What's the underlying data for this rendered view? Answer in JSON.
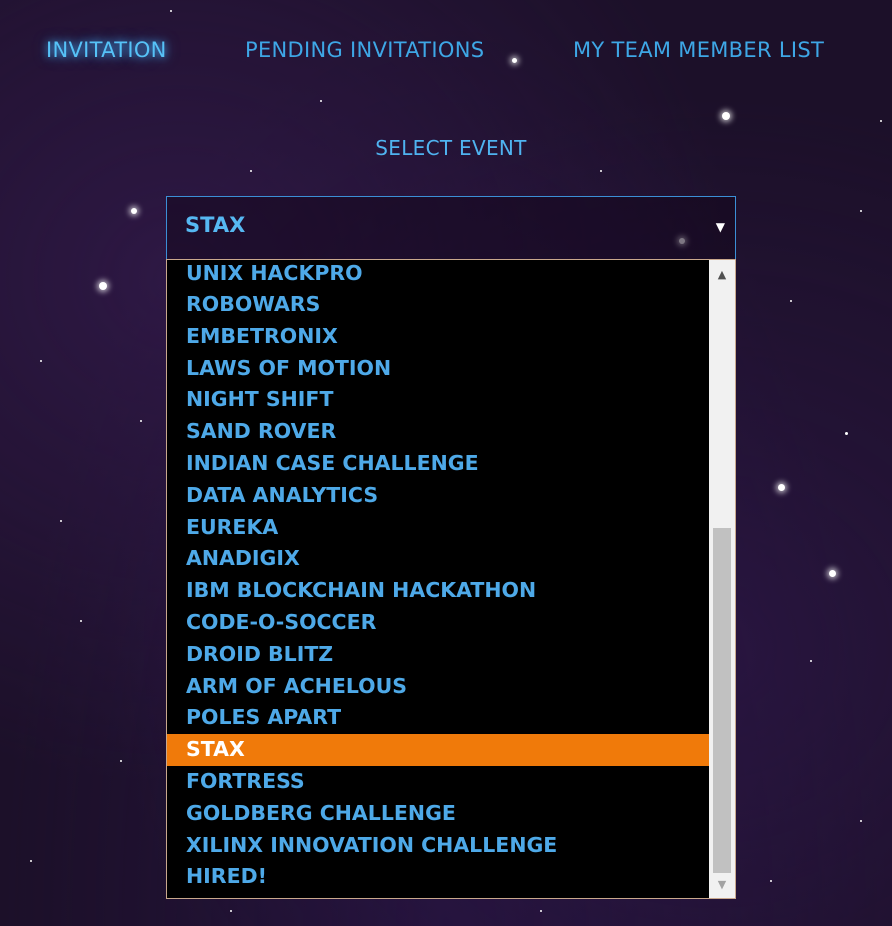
{
  "nav": {
    "items": [
      {
        "label": "INVITATION",
        "active": true
      },
      {
        "label": "PENDING INVITATIONS",
        "active": false
      },
      {
        "label": "MY TEAM MEMBER LIST",
        "active": false
      }
    ]
  },
  "select_event": {
    "heading": "SELECT EVENT",
    "value": "STAX",
    "caret_icon": "triangle-down-icon",
    "options": [
      "UNIX HACKPRO",
      "ROBOWARS",
      "EMBETRONIX",
      "LAWS OF MOTION",
      "NIGHT SHIFT",
      "SAND ROVER",
      "INDIAN CASE CHALLENGE",
      "DATA ANALYTICS",
      "EUREKA",
      "ANADIGIX",
      "IBM BLOCKCHAIN HACKATHON",
      "CODE-O-SOCCER",
      "DROID BLITZ",
      "ARM OF ACHELOUS",
      "POLES APART",
      "STAX",
      "FORTRESS",
      "GOLDBERG CHALLENGE",
      "XILINX INNOVATION CHALLENGE",
      "HIRED!"
    ],
    "selected_option": "STAX"
  },
  "colors": {
    "nav_text": "#3ea7e6",
    "option_text": "#4ea9e8",
    "selected_bg": "#f07a0a",
    "dropdown_bg": "#000000",
    "page_bg": "#1c1029"
  }
}
